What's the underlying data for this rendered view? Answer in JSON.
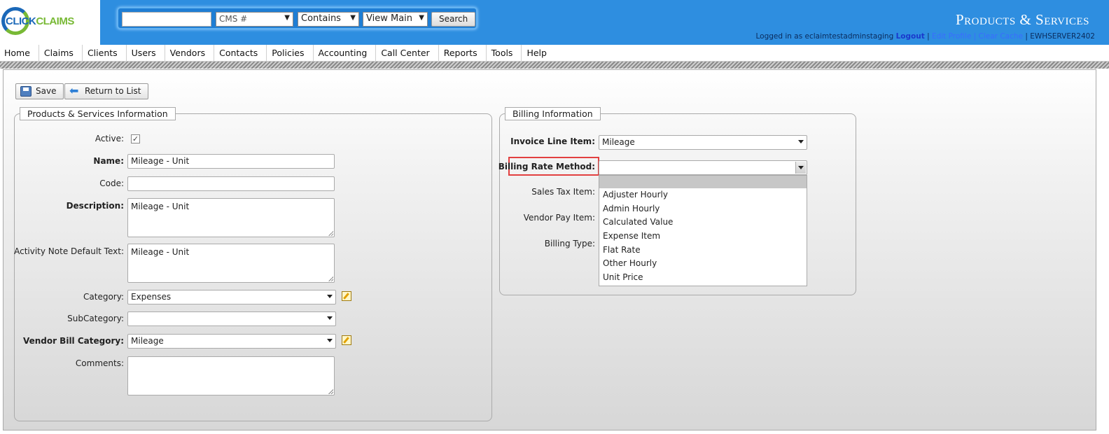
{
  "header": {
    "logo_part1": "CLICK",
    "logo_part2": "CLAIMS",
    "page_title": "Products & Services",
    "search": {
      "input_value": "",
      "field_select": "CMS #",
      "operator_select": "Contains",
      "view_select": "View Main",
      "button": "Search"
    },
    "user": {
      "logged_in_text": "Logged in as eclaimtestadminstaging",
      "logout": "Logout",
      "sep": "|",
      "edit_profile": "Edit Profile",
      "clear_cache": "Clear Cache",
      "server": "EWHSERVER2402"
    }
  },
  "menu": [
    "Home",
    "Claims",
    "Clients",
    "Users",
    "Vendors",
    "Contacts",
    "Policies",
    "Accounting",
    "Call Center",
    "Reports",
    "Tools",
    "Help"
  ],
  "toolbar": {
    "save": "Save",
    "return": "Return to List"
  },
  "ps_info": {
    "legend": "Products & Services Information",
    "active_label": "Active:",
    "active_checked": true,
    "name_label": "Name:",
    "name_value": "Mileage - Unit",
    "code_label": "Code:",
    "code_value": "",
    "description_label": "Description:",
    "description_value": "Mileage - Unit",
    "activity_label": "Activity Note Default Text:",
    "activity_value": "Mileage - Unit",
    "category_label": "Category:",
    "category_value": "Expenses",
    "subcategory_label": "SubCategory:",
    "subcategory_value": "",
    "vendor_bill_label": "Vendor Bill Category:",
    "vendor_bill_value": "Mileage",
    "comments_label": "Comments:",
    "comments_value": ""
  },
  "billing": {
    "legend": "Billing Information",
    "invoice_label": "Invoice Line Item:",
    "invoice_value": "Mileage",
    "rate_method_label": "Billing Rate Method:",
    "rate_method_value": "",
    "sales_tax_label": "Sales Tax Item:",
    "vendor_pay_label": "Vendor Pay Item:",
    "billing_type_label": "Billing Type:",
    "rate_method_options": [
      "Adjuster Hourly",
      "Admin Hourly",
      "Calculated Value",
      "Expense Item",
      "Flat Rate",
      "Other Hourly",
      "Unit Price"
    ],
    "highlight_color": "#e24040"
  }
}
